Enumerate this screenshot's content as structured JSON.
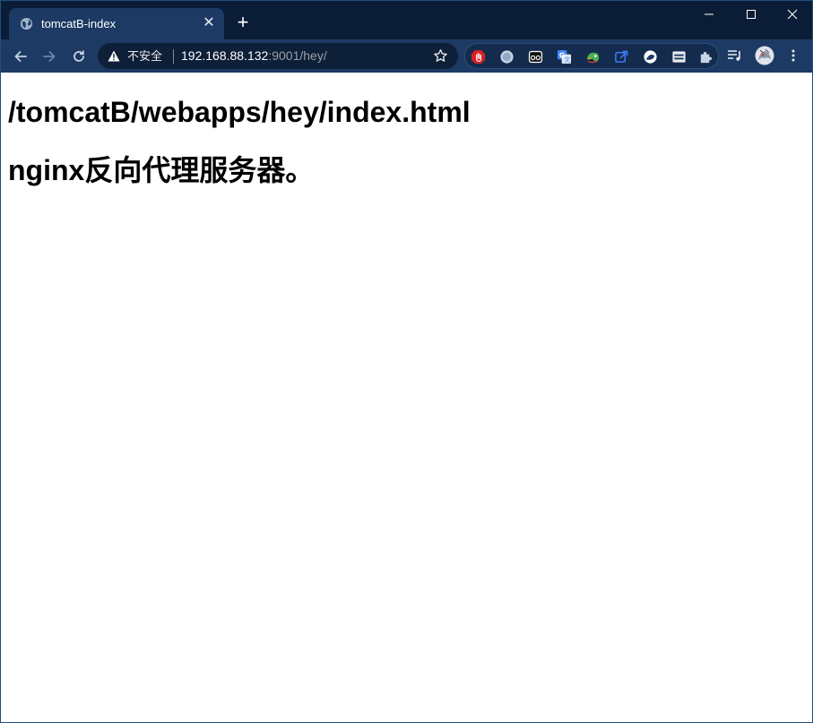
{
  "browser": {
    "tab": {
      "title": "tomcatB-index",
      "favicon": "globe-icon",
      "close_glyph": "✕"
    },
    "new_tab_glyph": "+",
    "address_bar": {
      "security_label": "不安全",
      "url_host": "192.168.88.132",
      "url_rest": ":9001/hey/"
    },
    "extensions": [
      "stop-hand-icon",
      "circle-icon",
      "owl-icon",
      "translate-icon",
      "chameleon-icon",
      "link-icon",
      "theme-icon",
      "list-box-icon"
    ]
  },
  "page": {
    "heading_path": "/tomcatB/webapps/hey/index.html",
    "heading_nginx": "nginx反向代理服务器。"
  },
  "colors": {
    "titlebar": "#0b1c36",
    "toolbar": "#1c3a64",
    "omnibox": "#0e1f38"
  }
}
